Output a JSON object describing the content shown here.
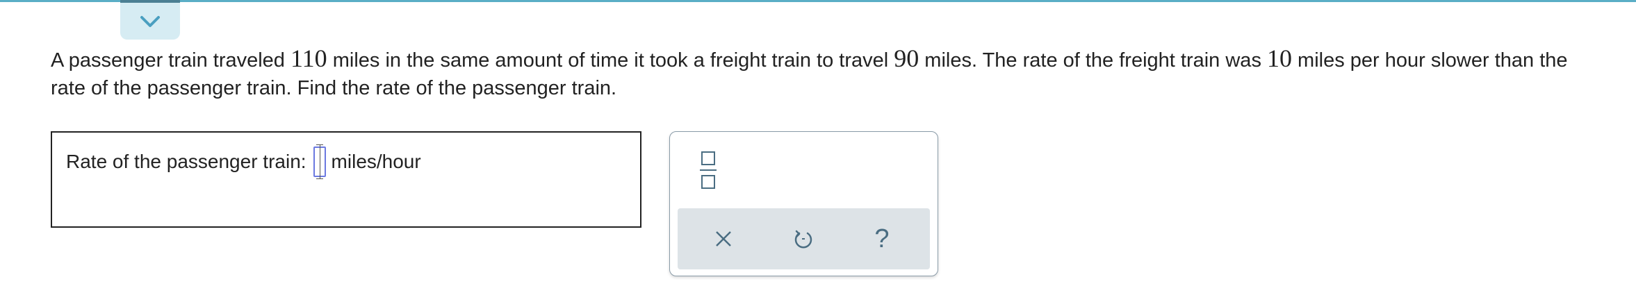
{
  "colors": {
    "accent": "#5aaec6",
    "tab_background": "#d6ecf3",
    "input_border": "#6b79e0",
    "toolbar_background": "#dde3e7",
    "icon_color": "#4a6d82"
  },
  "header": {
    "collapse_icon": "chevron-down-icon"
  },
  "question": {
    "part1": "A passenger train traveled ",
    "num1": "110",
    "part2": " miles in the same amount of time it took a freight train to travel ",
    "num2": "90",
    "part3": " miles. The rate of the freight train was ",
    "num3": "10",
    "part4": " miles per hour slower than the rate of the passenger train. Find the rate of the passenger train."
  },
  "answer": {
    "label": "Rate of the passenger train:",
    "value": "",
    "unit": "miles/hour"
  },
  "toolbox": {
    "fraction_icon": "fraction-icon",
    "clear_icon": "close-icon",
    "undo_icon": "undo-icon",
    "help_label": "?"
  }
}
